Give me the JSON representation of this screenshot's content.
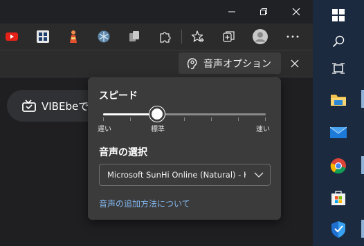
{
  "browser": {
    "window_controls": [
      "minimize",
      "restore",
      "close"
    ],
    "extensions": [
      "youtube-icon",
      "grid-icon",
      "figure-icon",
      "snowflake-icon",
      "copy-icon",
      "puzzle-icon",
      "favorites-icon",
      "collections-icon",
      "profile-icon",
      "more-icon"
    ],
    "read_aloud": {
      "voice_options_label": "音声オプション"
    },
    "content": {
      "vibe_label": "VIBEbeで"
    }
  },
  "popup": {
    "speed_title": "スピード",
    "speed_labels": {
      "slow": "遅い",
      "normal": "標準",
      "fast": "速い"
    },
    "speed_value": 0.33,
    "voice_title": "音声の選択",
    "voice_selected": "Microsoft SunHi Online (Natural) - Korean",
    "add_voice_link": "音声の追加方法について"
  },
  "colors": {
    "link": "#82b7f0",
    "taskbar": "#1b2a3f",
    "popup_bg": "#3b3b3b"
  }
}
